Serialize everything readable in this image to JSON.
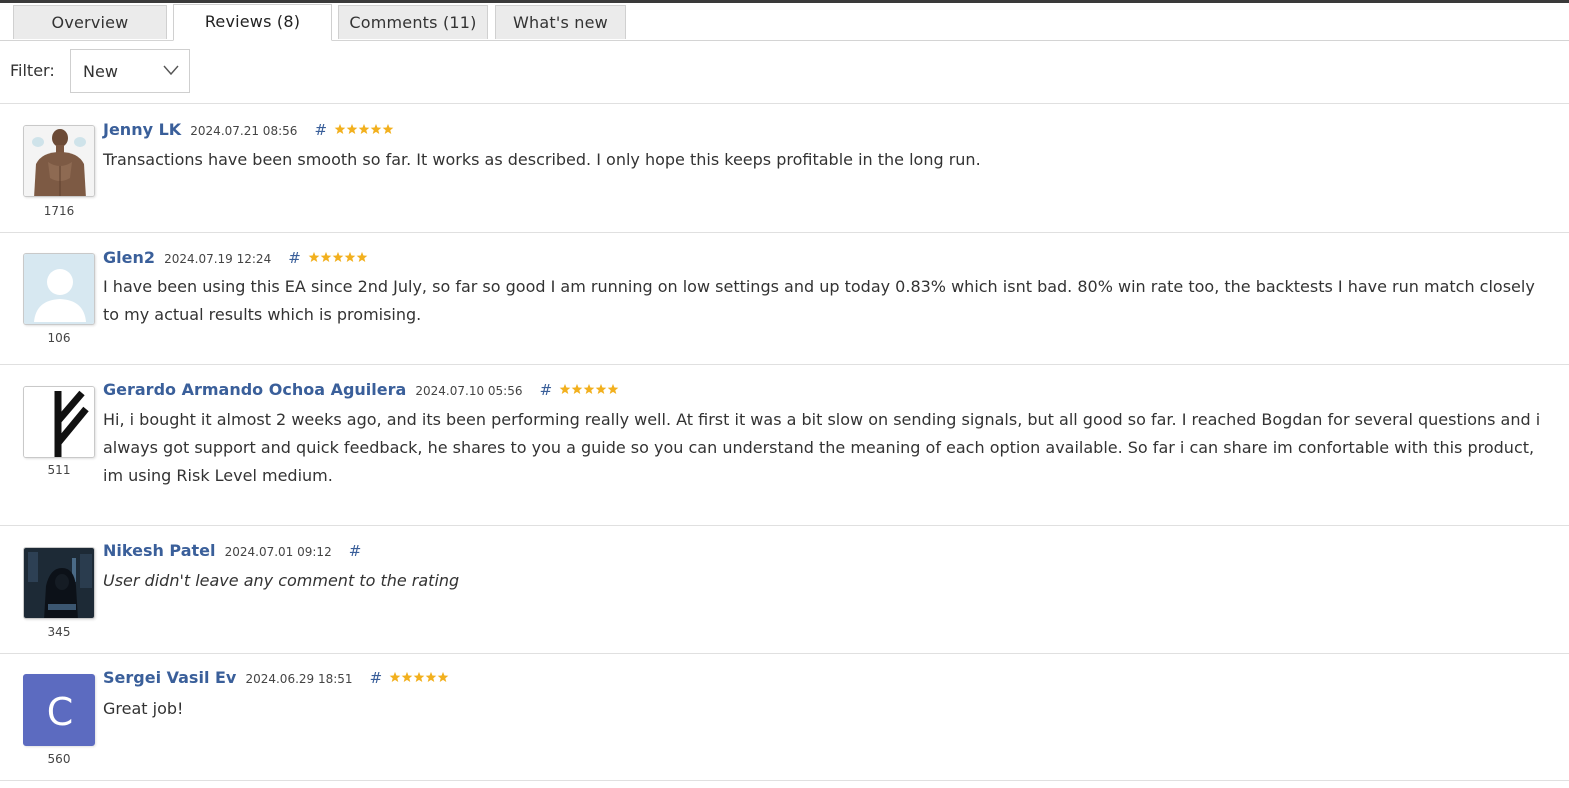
{
  "tabs": [
    {
      "label": "Overview"
    },
    {
      "label": "Reviews (8)"
    },
    {
      "label": "Comments (11)"
    },
    {
      "label": "What's new"
    }
  ],
  "filter": {
    "label": "Filter:",
    "value": "New"
  },
  "star_color": "#f2b01e",
  "link_color": "#3a5f9a",
  "reviews": [
    {
      "author": "Jenny LK",
      "date": "2024.07.21 08:56",
      "hash": "#",
      "stars": 5,
      "count": "1716",
      "text": "Transactions have been smooth so far. It works as described. I only hope this keeps profitable in the long run."
    },
    {
      "author": "Glen2",
      "date": "2024.07.19 12:24",
      "hash": "#",
      "stars": 5,
      "count": "106",
      "text": "I have been using this EA since 2nd July, so far so good I am running on low settings and up today 0.83% which isnt bad. 80% win rate too, the backtests I have run match closely to my actual results which is promising."
    },
    {
      "author": "Gerardo Armando Ochoa Aguilera",
      "date": "2024.07.10 05:56",
      "hash": "#",
      "stars": 5,
      "count": "511",
      "text": "Hi, i bought it almost 2 weeks ago, and its been performing really well. At first it was a bit slow on sending signals, but all good so far. I reached Bogdan for several questions and i always got support and quick feedback, he shares to you a guide so you can understand the meaning of each option available. So far i can share im confortable with this product, im using Risk Level medium."
    },
    {
      "author": "Nikesh Patel",
      "date": "2024.07.01 09:12",
      "hash": "#",
      "stars": 0,
      "count": "345",
      "text": "User didn't leave any comment to the rating"
    },
    {
      "author": "Sergei Vasil Ev",
      "date": "2024.06.29 18:51",
      "hash": "#",
      "stars": 5,
      "count": "560",
      "avatar_letter": "C",
      "text": "Great job!"
    }
  ]
}
